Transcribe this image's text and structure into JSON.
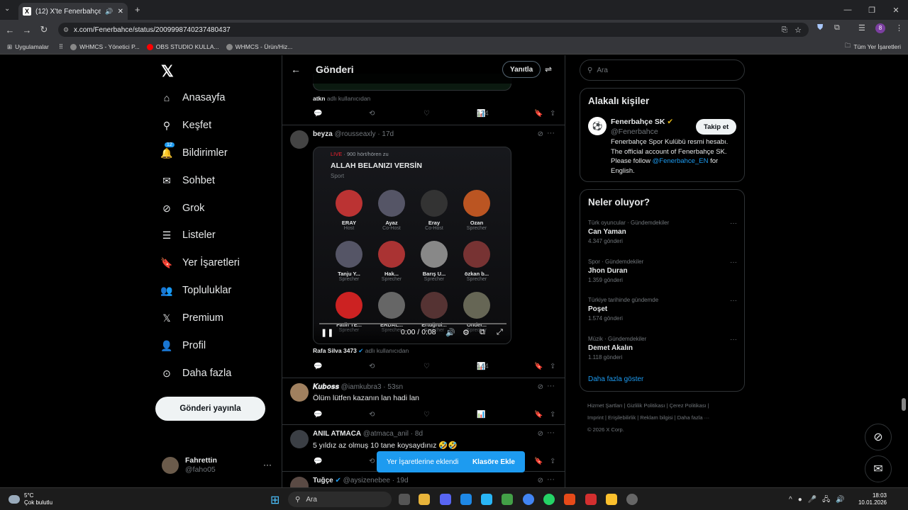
{
  "browser": {
    "tab_title": "(12) X'te Fenerbahçe SK: \"",
    "url": "x.com/Fenerbahce/status/2009998740237480437",
    "bookmarks": [
      "Uygulamalar",
      "WHMCS - Yönetici P...",
      "OBS STUDIO KULLA...",
      "WHMCS - Ürün/Hiz..."
    ],
    "all_bookmarks": "Tüm Yer İşaretleri"
  },
  "nav": {
    "items": [
      "Anasayfa",
      "Keşfet",
      "Bildirimler",
      "Sohbet",
      "Grok",
      "Listeler",
      "Yer İşaretleri",
      "Topluluklar",
      "Premium",
      "Profil",
      "Daha fazla"
    ],
    "notif_badge": "12",
    "post_button": "Gönderi yayınla",
    "user_name": "Fahrettin",
    "user_handle": "@faho05"
  },
  "header": {
    "title": "Gönderi",
    "reply": "Yanıtla"
  },
  "prev_tweet": {
    "retweeted_by": "atkn",
    "retweeted_suffix": "adlı kullanıcıdan",
    "views": "124"
  },
  "tweet1": {
    "name": "beyza",
    "handle": "@rousseaxly",
    "time": "· 17d",
    "live_label": "LIVE",
    "listeners": "· 900 hört/hören zu",
    "space_title": "ALLAH BELANIZI VERSİN",
    "space_category": "Sport",
    "participants": [
      {
        "name": "ERAY",
        "role": "Host"
      },
      {
        "name": "Ayaz",
        "role": "Co-Host"
      },
      {
        "name": "Eray",
        "role": "Co-Host"
      },
      {
        "name": "Ozan",
        "role": "Sprecher"
      },
      {
        "name": "Tanju Y...",
        "role": "Sprecher"
      },
      {
        "name": "Hak...",
        "role": "Sprecher"
      },
      {
        "name": "Barış U...",
        "role": "Sprecher"
      },
      {
        "name": "özkan b...",
        "role": "Sprecher"
      },
      {
        "name": "Fatih TE...",
        "role": "Sprecher"
      },
      {
        "name": "ERDAL...",
        "role": "Sprecher"
      },
      {
        "name": "Ertuğrul...",
        "role": "Sprecher"
      },
      {
        "name": "Onder...",
        "role": "Sprecher"
      }
    ],
    "video_time": "0:00 / 0:08",
    "video_progress": 0,
    "source_name": "Rafa Silva 3473",
    "source_suffix": "adlı kullanıcıdan",
    "views": "144"
  },
  "tweet2": {
    "name": "𝑲𝒖𝒃𝒐𝒔𝒔",
    "handle": "@iamkubra3",
    "time": "· 53sn",
    "text": "Ölüm lütfen kazanın lan hadi lan"
  },
  "tweet3": {
    "name": "ANIL ATMACA",
    "handle": "@atmaca_anil",
    "time": "· 8d",
    "text": "5 yıldız az olmuş 10 tane koysaydınız 🤣🤣"
  },
  "tweet4": {
    "name": "Tuğçe",
    "handle": "@aysizenebee",
    "time": "· 19d"
  },
  "toast": {
    "text": "Yer İşaretlerine eklendi",
    "action": "Klasöre Ekle"
  },
  "right": {
    "search_placeholder": "Ara",
    "related_title": "Alakalı kişiler",
    "account_name": "Fenerbahçe SK",
    "account_handle": "@Fenerbahce",
    "follow": "Takip et",
    "bio_text": "Fenerbahçe Spor Kulübü resmi hesabı. The official account of Fenerbahçe SK. Please follow",
    "bio_link": "@Fenerbahce_EN",
    "bio_end": "for English.",
    "trends_title": "Neler oluyor?",
    "trends": [
      {
        "context": "Türk oyuncular · Gündemdekiler",
        "name": "Can Yaman",
        "count": "4.347 gönderi"
      },
      {
        "context": "Spor · Gündemdekiler",
        "name": "Jhon Duran",
        "count": "1.359 gönderi"
      },
      {
        "context": "Türkiye tarihinde gündemde",
        "name": "Poşet",
        "count": "1.574 gönderi"
      },
      {
        "context": "Müzik · Gündemdekiler",
        "name": "Demet Akalın",
        "count": "1.118 gönderi"
      }
    ],
    "show_more": "Daha fazla göster",
    "footer_line1": "Hizmet Şartları  |  Gizlilik Politikası  |  Çerez Politikası  |",
    "footer_line2": "Imprint  |  Erişilebilirlik  |  Reklam bilgisi  |  Daha fazla ···",
    "footer_line3": "© 2026 X Corp."
  },
  "taskbar": {
    "temp": "5°C",
    "weather": "Çok bulutlu",
    "search": "Ara",
    "time": "18:03",
    "date": "10.01.2026"
  }
}
